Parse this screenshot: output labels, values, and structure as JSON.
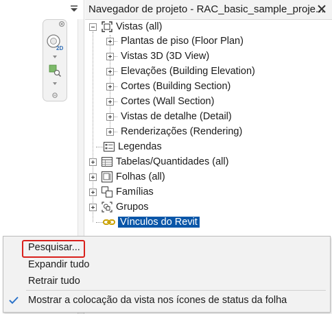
{
  "browser": {
    "title": "Navegador de projeto - RAC_basic_sample_proje...",
    "tree": {
      "root_label": "Vistas (all)",
      "views": [
        "Plantas de piso (Floor Plan)",
        "Vistas 3D (3D View)",
        "Elevações (Building Elevation)",
        "Cortes (Building Section)",
        "Cortes (Wall Section)",
        "Vistas de detalhe (Detail)",
        "Renderizações (Rendering)"
      ],
      "legends": "Legendas",
      "schedules": "Tabelas/Quantidades (all)",
      "sheets": "Folhas (all)",
      "families": "Famílias",
      "groups": "Grupos",
      "revit_links": "Vínculos do Revit"
    }
  },
  "navigation_bar": {
    "wheel_badge": "2D"
  },
  "context_menu": {
    "items": [
      "Pesquisar...",
      "Expandir tudo",
      "Retrair tudo"
    ],
    "checked_item": "Mostrar a colocação da vista nos ícones de status da folha",
    "highlight_color": "#d9201b"
  },
  "colors": {
    "selection": "#0a56a8",
    "menu_bg": "#f2f2f2"
  }
}
